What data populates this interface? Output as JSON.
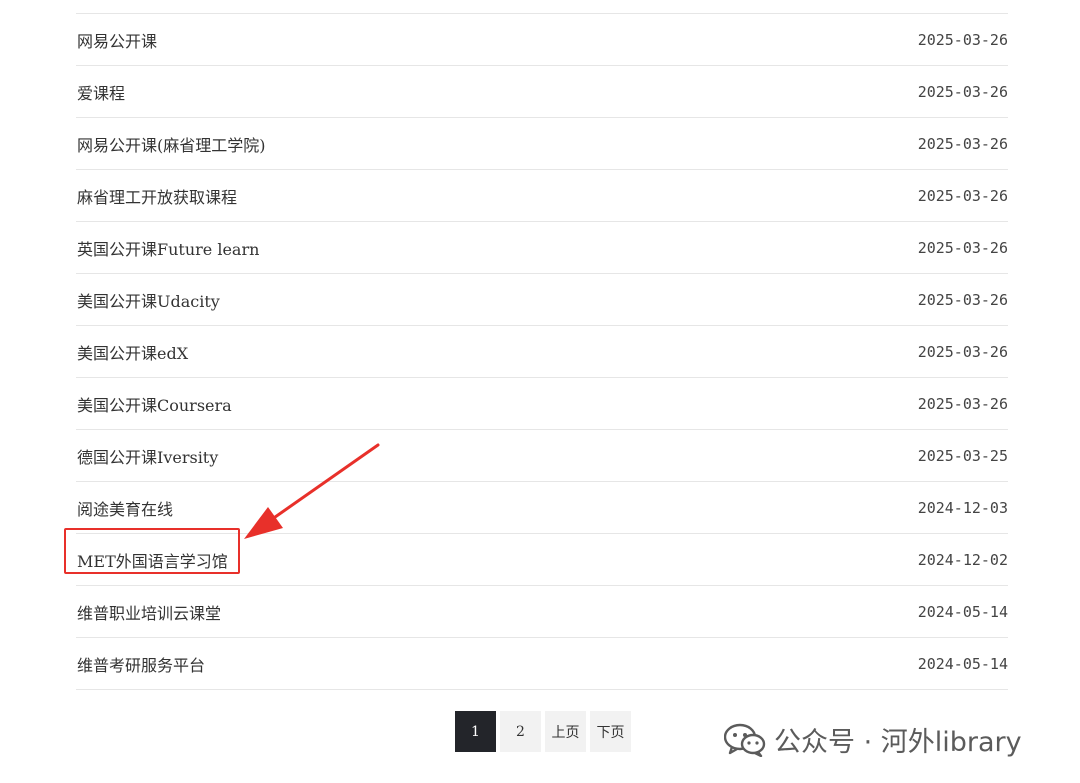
{
  "list": {
    "items": [
      {
        "title": "网易公开课",
        "date": "2025-03-26"
      },
      {
        "title": "爱课程",
        "date": "2025-03-26"
      },
      {
        "title": "网易公开课(麻省理工学院)",
        "date": "2025-03-26"
      },
      {
        "title": "麻省理工开放获取课程",
        "date": "2025-03-26"
      },
      {
        "title": "英国公开课Future learn",
        "date": "2025-03-26"
      },
      {
        "title": "美国公开课Udacity",
        "date": "2025-03-26"
      },
      {
        "title": "美国公开课edX",
        "date": "2025-03-26"
      },
      {
        "title": "美国公开课Coursera",
        "date": "2025-03-26"
      },
      {
        "title": "德国公开课Iversity",
        "date": "2025-03-25"
      },
      {
        "title": "阅途美育在线",
        "date": "2024-12-03"
      },
      {
        "title": "MET外国语言学习馆",
        "date": "2024-12-02"
      },
      {
        "title": "维普职业培训云课堂",
        "date": "2024-05-14"
      },
      {
        "title": "维普考研服务平台",
        "date": "2024-05-14"
      }
    ],
    "highlighted_index": 10,
    "highlight_color": "#e8302a"
  },
  "pagination": {
    "pages": [
      "1",
      "2"
    ],
    "current": "1",
    "prev_label": "上页",
    "next_label": "下页",
    "active_color": "#23252a"
  },
  "watermark": {
    "icon": "wechat-icon",
    "text": "公众号 · 河外library"
  }
}
